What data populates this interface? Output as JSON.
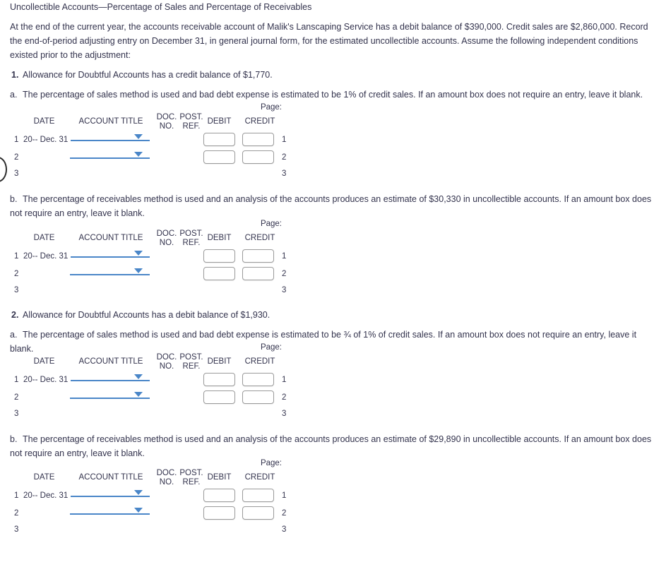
{
  "title": "Uncollectible Accounts—Percentage of Sales and Percentage of Receivables",
  "intro": "At the end of the current year, the accounts receivable account of Malik's Lanscaping Service has a debit balance of $390,000. Credit sales are $2,860,000. Record the end-of-period adjusting entry on December 31, in general journal form, for the estimated uncollectible accounts. Assume the following independent conditions existed prior to the adjustment:",
  "items": [
    {
      "number": "1.",
      "text": "Allowance for Doubtful Accounts has a credit balance of $1,770.",
      "parts": [
        {
          "letter": "a.",
          "text": "The percentage of sales method is used and bad debt expense is estimated to be 1% of credit sales. If an amount box does not require an entry, leave it blank."
        },
        {
          "letter": "b.",
          "text": "The percentage of receivables method is used and an analysis of the accounts produces an estimate of $30,330 in uncollectible accounts. If an amount box does not require an entry, leave it blank."
        }
      ]
    },
    {
      "number": "2.",
      "text": "Allowance for Doubtful Accounts has a debit balance of $1,930.",
      "parts": [
        {
          "letter": "a.",
          "text": "The percentage of sales method is used and bad debt expense is estimated to be ¾ of 1% of credit sales. If an amount box does not require an entry, leave it blank."
        },
        {
          "letter": "b.",
          "text": "The percentage of receivables method is used and an analysis of the accounts produces an estimate of $29,890 in uncollectible accounts. If an amount box does not require an entry, leave it blank."
        }
      ]
    }
  ],
  "journal": {
    "page_label": "Page:",
    "page_value": "",
    "headers": {
      "date": "DATE",
      "account_title": "ACCOUNT TITLE",
      "doc_no_line1": "DOC.",
      "doc_no_line2": "NO.",
      "post_ref_line1": "POST.",
      "post_ref_line2": "REF.",
      "debit": "DEBIT",
      "credit": "CREDIT"
    },
    "rows": [
      {
        "num": "1",
        "date": "20-- Dec. 31",
        "account": "",
        "debit": "",
        "credit": ""
      },
      {
        "num": "2",
        "date": "",
        "account": "",
        "debit": "",
        "credit": ""
      },
      {
        "num": "3",
        "date": "",
        "account": "",
        "debit": "",
        "credit": ""
      }
    ]
  },
  "colors": {
    "text": "#33334d",
    "accent_blue": "#4a86c8",
    "box_border": "#9b9b9b",
    "background": "#ffffff"
  }
}
